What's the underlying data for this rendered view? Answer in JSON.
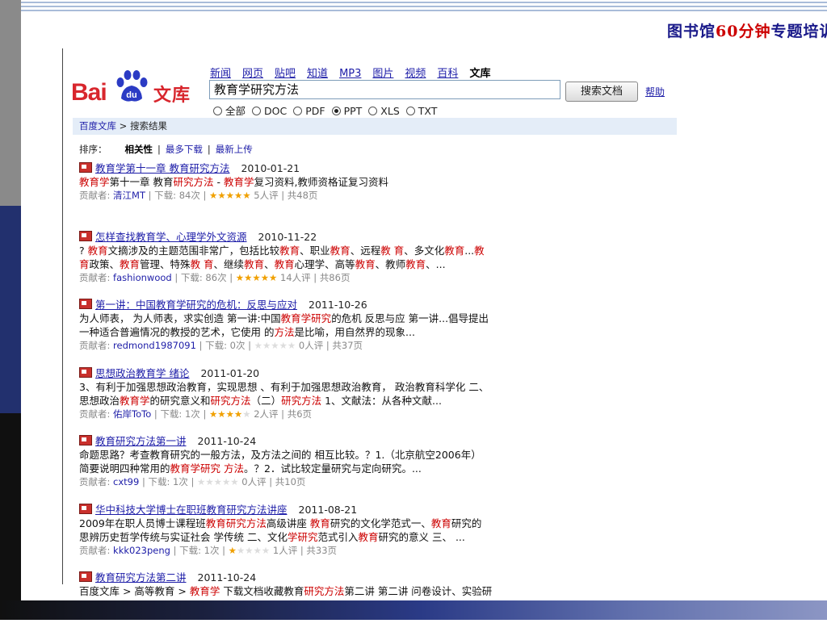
{
  "slide_title": {
    "p1": "图书馆",
    "p2": "60分",
    "p3": "钟",
    "p4": "专题培训"
  },
  "logo": {
    "bai": "Bai",
    "du": "du",
    "wenku": "文库"
  },
  "nav": [
    "新闻",
    "网页",
    "贴吧",
    "知道",
    "MP3",
    "图片",
    "视频",
    "百科"
  ],
  "nav_current": "文库",
  "search": {
    "value": "教育学研究方法",
    "button": "搜索文档",
    "help": "帮助"
  },
  "filters": [
    {
      "label": "全部",
      "checked": false
    },
    {
      "label": "DOC",
      "checked": false
    },
    {
      "label": "PDF",
      "checked": false
    },
    {
      "label": "PPT",
      "checked": true
    },
    {
      "label": "XLS",
      "checked": false
    },
    {
      "label": "TXT",
      "checked": false
    }
  ],
  "breadcrumb": {
    "root": "百度文库",
    "sep": " > ",
    "current": "搜索结果"
  },
  "sort": {
    "label": "排序：",
    "active": "相关性",
    "options": [
      "最多下载",
      "最新上传"
    ]
  },
  "colors": {
    "link": "#1d1da8",
    "highlight": "#cc0000",
    "brand": "#d8262d",
    "star": "#f0a000"
  },
  "results": [
    {
      "title": [
        {
          "t": "教育学第十一章 教育研究方法",
          "h": false
        }
      ],
      "date": "2010-01-21",
      "snippet": [
        [
          {
            "t": "教育学",
            "h": true
          },
          {
            "t": "第十一章 教育",
            "h": false
          },
          {
            "t": "研究方法",
            "h": true
          },
          {
            "t": " - ",
            "h": false
          },
          {
            "t": "教育学",
            "h": true
          },
          {
            "t": "复习资料,教师资格证复习资料",
            "h": false
          }
        ]
      ],
      "contributor_label": "贡献者: ",
      "contributor": "清江MT",
      "downloads": "下载: 84次",
      "rating": 4.5,
      "reviews": "5人评",
      "pages": "共48页"
    },
    {
      "title": [
        {
          "t": "怎样查找教育学、心理学外文资源",
          "h": false
        }
      ],
      "date": "2010-11-22",
      "snippet": [
        [
          {
            "t": "? ",
            "h": false
          },
          {
            "t": "教育",
            "h": true
          },
          {
            "t": "文摘涉及的主题范围非常广，包括比较",
            "h": false
          },
          {
            "t": "教育",
            "h": true
          },
          {
            "t": "、职业",
            "h": false
          },
          {
            "t": "教育",
            "h": true
          },
          {
            "t": "、远程",
            "h": false
          },
          {
            "t": "教 育",
            "h": true
          },
          {
            "t": "、多文化",
            "h": false
          },
          {
            "t": "教育",
            "h": true
          },
          {
            "t": "...",
            "h": false
          },
          {
            "t": "教",
            "h": true
          }
        ],
        [
          {
            "t": "育",
            "h": true
          },
          {
            "t": "政策、",
            "h": false
          },
          {
            "t": "教育",
            "h": true
          },
          {
            "t": "管理、特殊",
            "h": false
          },
          {
            "t": "教 育",
            "h": true
          },
          {
            "t": "、继续",
            "h": false
          },
          {
            "t": "教育",
            "h": true
          },
          {
            "t": "、",
            "h": false
          },
          {
            "t": "教育",
            "h": true
          },
          {
            "t": "心理学、高等",
            "h": false
          },
          {
            "t": "教育",
            "h": true
          },
          {
            "t": "、教师",
            "h": false
          },
          {
            "t": "教育",
            "h": true
          },
          {
            "t": "、...",
            "h": false
          }
        ]
      ],
      "contributor_label": "贡献者: ",
      "contributor": "fashionwood",
      "downloads": "下载: 86次",
      "rating": 4.5,
      "reviews": "14人评",
      "pages": "共86页"
    },
    {
      "title": [
        {
          "t": "第一讲：中国教育学研究的危机：反思与应对",
          "h": false
        }
      ],
      "date": "2011-10-26",
      "snippet": [
        [
          {
            "t": "为人师表，  为人师表，求实创造 第一讲:中国",
            "h": false
          },
          {
            "t": "教育学研究",
            "h": true
          },
          {
            "t": "的危机 反思与应 第一讲...倡导提出",
            "h": false
          }
        ],
        [
          {
            "t": "一种适合普遍情况的教授的艺术，它使用 的",
            "h": false
          },
          {
            "t": "方法",
            "h": true
          },
          {
            "t": "是比喻，用自然界的现象...",
            "h": false
          }
        ]
      ],
      "contributor_label": "贡献者: ",
      "contributor": "redmond1987091",
      "downloads": "下载: 0次",
      "rating": 0,
      "reviews": "0人评",
      "pages": "共37页"
    },
    {
      "title": [
        {
          "t": "思想政治教育学 绪论",
          "h": false
        }
      ],
      "date": "2011-01-20",
      "snippet": [
        [
          {
            "t": "3、有利于加强思想政治教育，实现思想 、有利于加强思想政治教育，  政治教育科学化 二、",
            "h": false
          }
        ],
        [
          {
            "t": "思想政治",
            "h": false
          },
          {
            "t": "教育学",
            "h": true
          },
          {
            "t": "的研究意义和",
            "h": false
          },
          {
            "t": "研究方法",
            "h": true
          },
          {
            "t": "（二）",
            "h": false
          },
          {
            "t": "研究方法",
            "h": true
          },
          {
            "t": " 1、文献法：从各种文献...",
            "h": false
          }
        ]
      ],
      "contributor_label": "贡献者: ",
      "contributor": "佑岸ToTo",
      "downloads": "下载: 1次",
      "rating": 3.5,
      "reviews": "2人评",
      "pages": "共6页"
    },
    {
      "title": [
        {
          "t": "教育研究方法第一讲",
          "h": false
        }
      ],
      "date": "2011-10-24",
      "snippet": [
        [
          {
            "t": "命题思路？考查教育研究的一般方法，及方法之间的 相互比较。？1.（北京航空2006年）",
            "h": false
          }
        ],
        [
          {
            "t": "简要说明四种常用的",
            "h": false
          },
          {
            "t": "教育学研究 方法",
            "h": true
          },
          {
            "t": "。？2．试比较定量研究与定向研究。...",
            "h": false
          }
        ]
      ],
      "contributor_label": "贡献者: ",
      "contributor": "cxt99",
      "downloads": "下载: 1次",
      "rating": 0,
      "reviews": "0人评",
      "pages": "共10页"
    },
    {
      "title": [
        {
          "t": "华中科技大学博士在职班教育研究方法讲座",
          "h": false
        }
      ],
      "date": "2011-08-21",
      "snippet": [
        [
          {
            "t": "2009年在职人员博士课程班",
            "h": false
          },
          {
            "t": "教育研究方法",
            "h": true
          },
          {
            "t": "高级讲座 ",
            "h": false
          },
          {
            "t": "教育",
            "h": true
          },
          {
            "t": "研究的文化学范式一、",
            "h": false
          },
          {
            "t": "教育",
            "h": true
          },
          {
            "t": "研究的",
            "h": false
          }
        ],
        [
          {
            "t": "思辨历史哲学传统与实证社会 学传统 二、文化",
            "h": false
          },
          {
            "t": "学研究",
            "h": true
          },
          {
            "t": "范式引入",
            "h": false
          },
          {
            "t": "教育",
            "h": true
          },
          {
            "t": "研究的意义 三、 ...",
            "h": false
          }
        ]
      ],
      "contributor_label": "贡献者: ",
      "contributor": "kkk023peng",
      "downloads": "下载: 1次",
      "rating": 1,
      "reviews": "1人评",
      "pages": "共33页"
    },
    {
      "title": [
        {
          "t": "教育研究方法第二讲",
          "h": false
        }
      ],
      "date": "2011-10-24",
      "snippet": [
        [
          {
            "t": "百度文库 > 高等教育 > ",
            "h": false
          },
          {
            "t": "教育学",
            "h": true
          },
          {
            "t": " 下载文档收藏教育",
            "h": false
          },
          {
            "t": "研究方法",
            "h": true
          },
          {
            "t": "第二讲 第二讲 问卷设计、实验研",
            "h": false
          }
        ]
      ]
    }
  ]
}
